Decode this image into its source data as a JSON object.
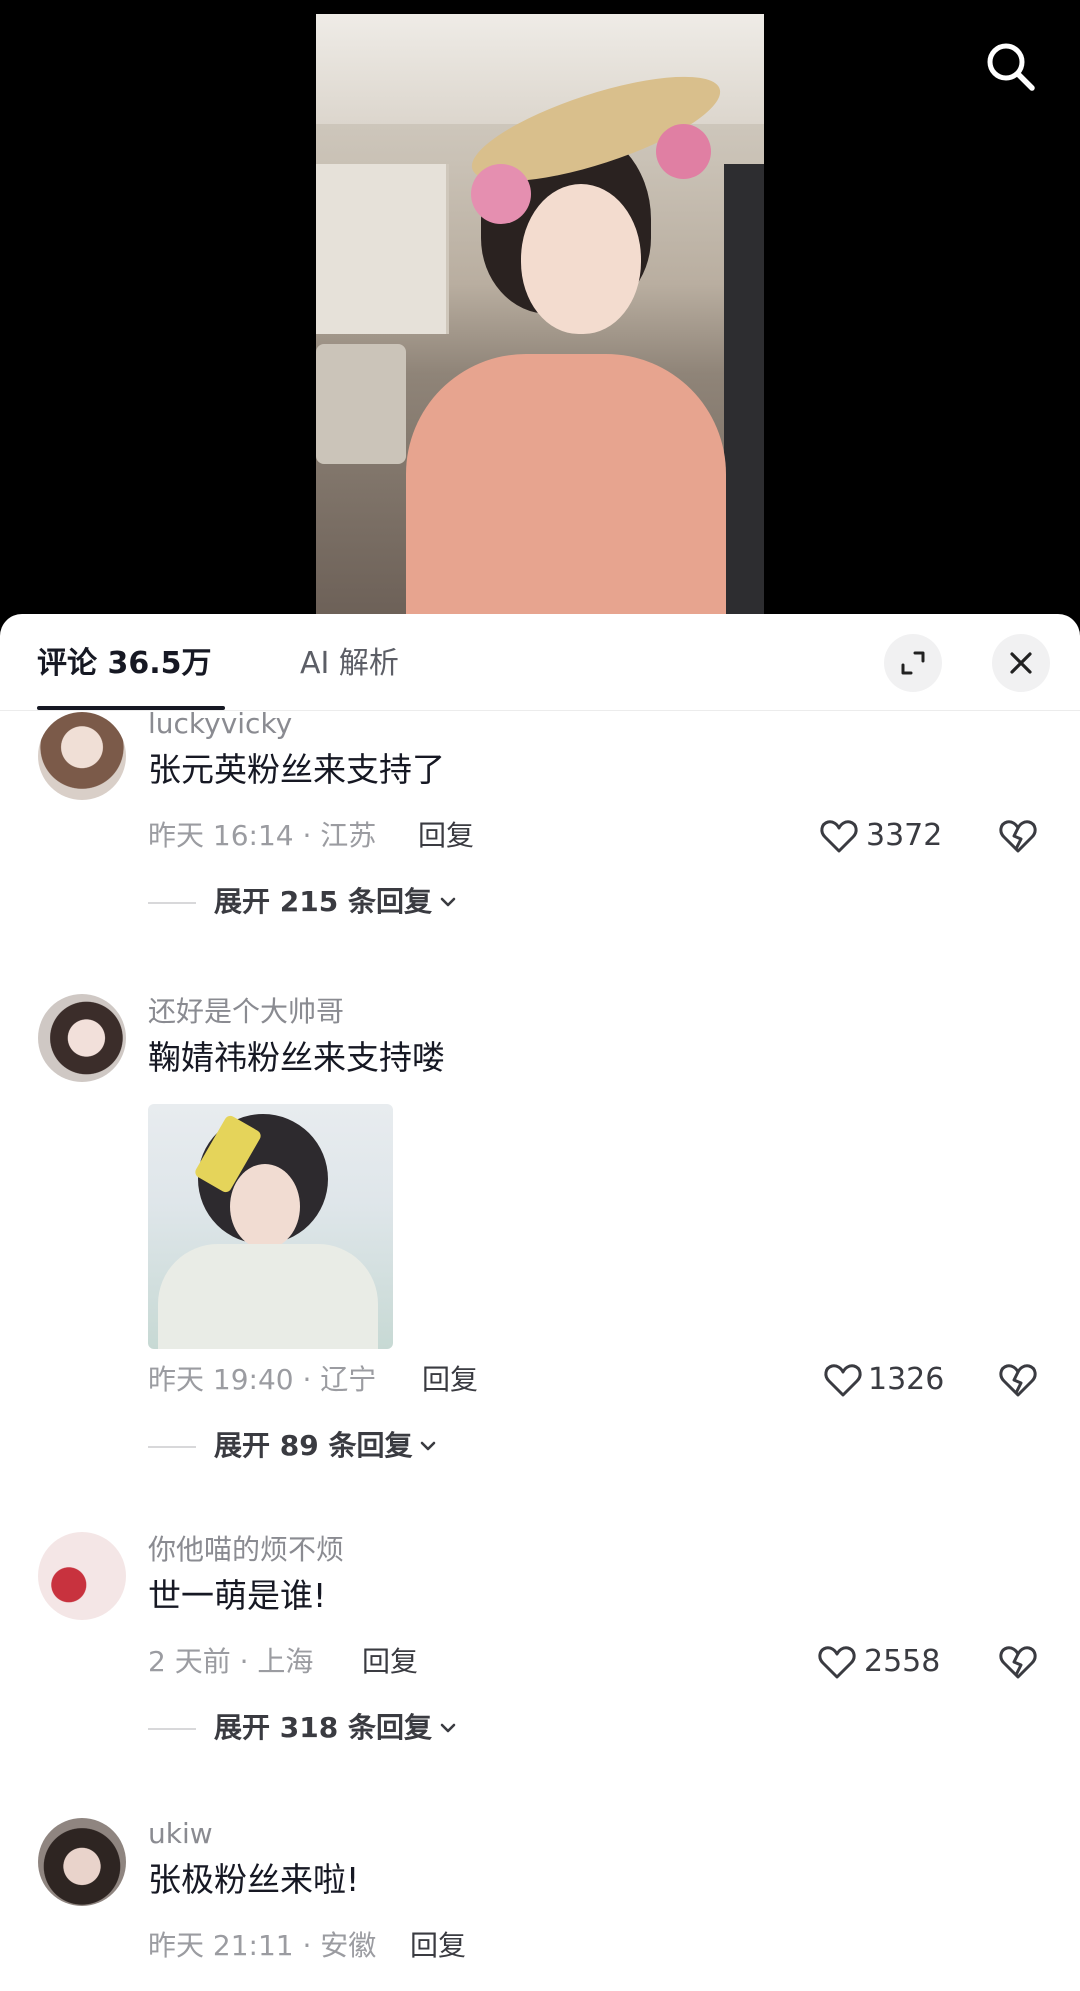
{
  "header": {
    "comments_tab": "评论 36.5万",
    "ai_tab": "AI 解析"
  },
  "icons": {
    "search": "search-icon",
    "expand": "expand-icon",
    "close": "close-icon",
    "like": "heart-icon",
    "dislike": "broken-heart-icon",
    "chevron": "chevron-down-icon"
  },
  "comments": [
    {
      "username": "luckyvicky",
      "text": "张元英粉丝来支持了",
      "meta": "昨天 16:14 · 江苏",
      "reply": "回复",
      "likes": "3372",
      "expand": "展开 215 条回复"
    },
    {
      "username": "还好是个大帅哥",
      "text": "鞠婧祎粉丝来支持喽",
      "meta": "昨天 19:40 · 辽宁",
      "reply": "回复",
      "likes": "1326",
      "expand": "展开 89 条回复"
    },
    {
      "username": "你他喵的烦不烦",
      "text": "世一萌是谁!",
      "meta": "2 天前 · 上海",
      "reply": "回复",
      "likes": "2558",
      "expand": "展开 318 条回复"
    },
    {
      "username": "ukiw",
      "text": "张极粉丝来啦!",
      "meta": "昨天 21:11 · 安徽",
      "reply": "回复"
    }
  ]
}
